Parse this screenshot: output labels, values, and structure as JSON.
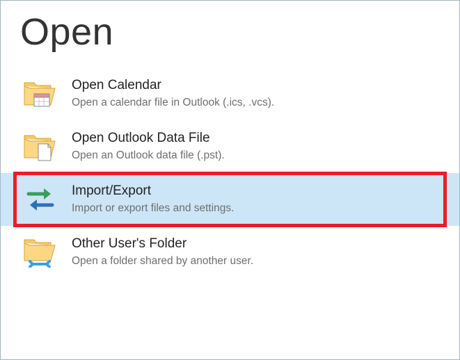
{
  "header": {
    "title": "Open"
  },
  "items": [
    {
      "title": "Open Calendar",
      "desc": "Open a calendar file in Outlook (.ics, .vcs).",
      "icon": "folder-calendar-icon",
      "highlighted": false
    },
    {
      "title": "Open Outlook Data File",
      "desc": "Open an Outlook data file (.pst).",
      "icon": "folder-file-icon",
      "highlighted": false
    },
    {
      "title": "Import/Export",
      "desc": "Import or export files and settings.",
      "icon": "import-export-icon",
      "highlighted": true
    },
    {
      "title": "Other User's Folder",
      "desc": "Open a folder shared by another user.",
      "icon": "folder-share-icon",
      "highlighted": false
    }
  ],
  "colors": {
    "folder_fill": "#fcd884",
    "folder_stroke": "#d6a23a",
    "accent_blue": "#2f6fb8",
    "accent_green": "#3a9e5a",
    "highlight_bg": "#cde6f7",
    "highlight_border": "#ec1c24"
  }
}
